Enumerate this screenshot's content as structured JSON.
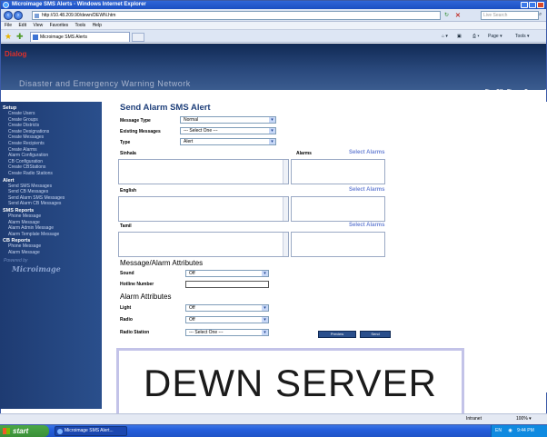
{
  "window": {
    "title": "Microimage SMS Alerts - Windows Internet Explorer",
    "url": "http://10.48.209.90/dewn/DEWN.htm",
    "search_placeholder": "Live Search",
    "menu": [
      "File",
      "Edit",
      "View",
      "Favorites",
      "Tools",
      "Help"
    ],
    "tab_label": "Microimage SMS Alerts",
    "commands": [
      "Page ▾",
      "Tools ▾"
    ]
  },
  "app": {
    "logo_text": "Dialog",
    "subtitle": "Disaster and Emergency Warning Network",
    "header_links": [
      "Sign Off",
      "Change Password"
    ]
  },
  "sidebar": {
    "groups": [
      {
        "title": "Setup",
        "items": [
          "Create Users",
          "Create Groups",
          "Create Districts",
          "Create Designations",
          "Create Messages",
          "Create Recipients",
          "Create Alarms",
          "Alarm Configuration",
          "CB Configuration",
          "Create CBStations",
          "Create Radio Stations"
        ]
      },
      {
        "title": "Alert",
        "items": [
          "Send SMS Messages",
          "Send CB Messages",
          "Send Alarm SMS Messages",
          "Send Alarm CB Messages"
        ]
      },
      {
        "title": "SMS Reports",
        "items": [
          "Phone Message",
          "Alarm Message",
          "Alarm Admin Message",
          "Alarm Template Message"
        ]
      },
      {
        "title": "CB Reports",
        "items": [
          "Phone Message",
          "Alarm Message"
        ]
      }
    ],
    "powered_by": "Powered by",
    "brand": "Microimage"
  },
  "form": {
    "title": "Send Alarm SMS Alert",
    "message_type_label": "Message Type",
    "message_type_value": "Normal",
    "existing_messages_label": "Existing Messages",
    "existing_messages_value": "--- Select One ---",
    "type_label": "Type",
    "type_value": "Alert",
    "sinhala_label": "Sinhala",
    "alarms_label": "Alarms",
    "select_alarms": "Select Alarms",
    "english_label": "English",
    "tamil_label": "Tamil",
    "attributes_title": "Message/Alarm Attributes",
    "sound_label": "Sound",
    "sound_value": "Off",
    "hotline_label": "Hotline Number",
    "alarm_attributes_title": "Alarm Attributes",
    "light_label": "Light",
    "light_value": "Off",
    "radio_label": "Radio",
    "radio_value": "Off",
    "radio_station_label": "Radio Station",
    "radio_station_value": "--- Select One ---",
    "preview_button": "Preview",
    "send_button": "Send"
  },
  "overlay": {
    "text": "DEWN SERVER"
  },
  "statusbar": {
    "zone": "Intranet",
    "zoom": "100% ▾"
  },
  "taskbar": {
    "start_label": "start",
    "task_label": "Microimage SMS Alert...",
    "lang": "EN",
    "time": "9:44 PM"
  }
}
